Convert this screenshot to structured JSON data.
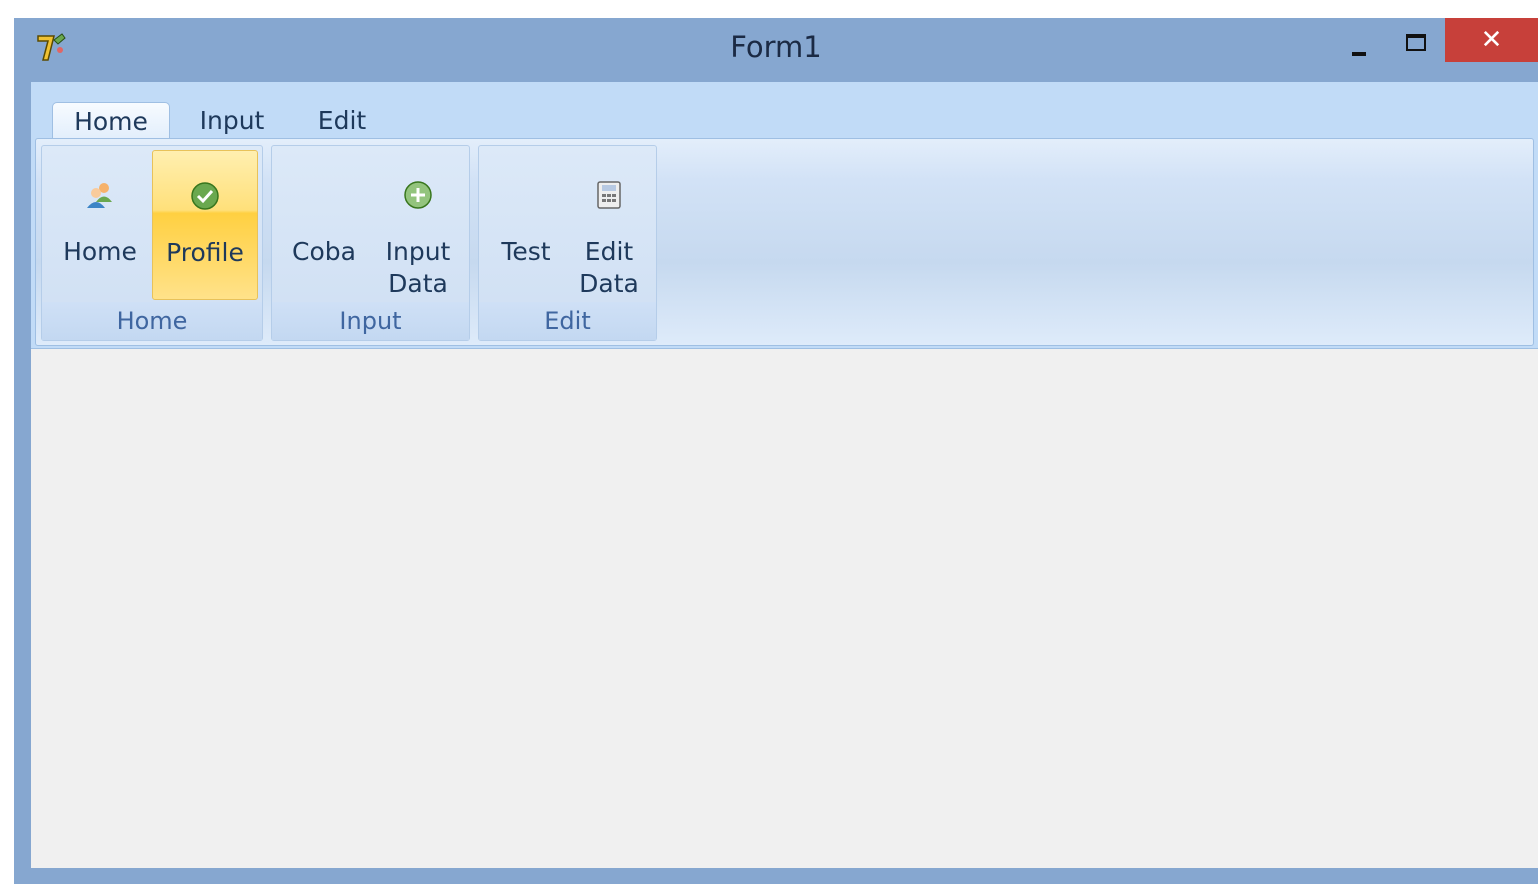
{
  "window": {
    "title": "Form1",
    "icons": {
      "app": "app-logo-icon",
      "minimize": "minimize-icon",
      "maximize": "maximize-icon",
      "close": "close-icon"
    },
    "close_glyph": "✕"
  },
  "ribbon": {
    "tabs": [
      {
        "label": "Home",
        "active": true
      },
      {
        "label": "Input",
        "active": false
      },
      {
        "label": "Edit",
        "active": false
      }
    ],
    "groups": [
      {
        "caption": "Home",
        "buttons": [
          {
            "label": "Home",
            "icon": "users-icon"
          },
          {
            "label": "Profile",
            "icon": "check-circle-icon",
            "highlighted": true
          }
        ]
      },
      {
        "caption": "Input",
        "buttons": [
          {
            "label": "Coba",
            "icon": ""
          },
          {
            "label": "Input\nData",
            "icon": "add-circle-icon"
          }
        ]
      },
      {
        "caption": "Edit",
        "buttons": [
          {
            "label": "Test",
            "icon": ""
          },
          {
            "label": "Edit\nData",
            "icon": "calculator-icon"
          }
        ]
      }
    ]
  },
  "colors": {
    "titlebar": "#86a7d0",
    "ribbon_background": "#c1dbf7",
    "close_button": "#c7403a",
    "highlight": "#ffd041",
    "client_area": "#f0f0f0"
  }
}
